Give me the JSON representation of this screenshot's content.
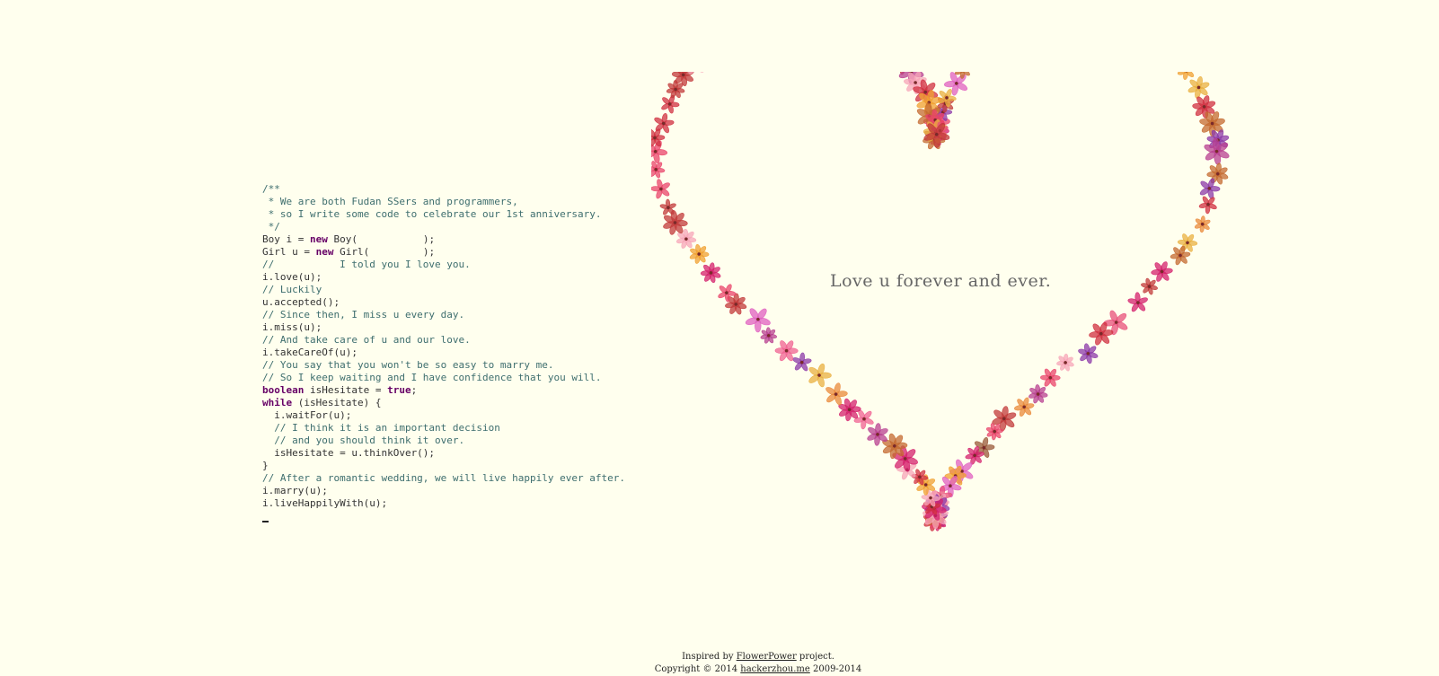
{
  "code": {
    "lines": [
      [
        {
          "cls": "comments",
          "text": "/**"
        }
      ],
      [
        {
          "cls": "comments",
          "text": " * We are both Fudan SSers and programmers,"
        }
      ],
      [
        {
          "cls": "comments",
          "text": " * so I write some code to celebrate our 1st anniversary."
        }
      ],
      [
        {
          "cls": "comments",
          "text": " */"
        }
      ],
      [
        {
          "cls": "",
          "text": "Boy i = "
        },
        {
          "cls": "keyword",
          "text": "new"
        },
        {
          "cls": "",
          "text": " Boy("
        },
        {
          "cls": "",
          "text": "           "
        },
        {
          "cls": "",
          "text": ");"
        }
      ],
      [
        {
          "cls": "",
          "text": "Girl u = "
        },
        {
          "cls": "keyword",
          "text": "new"
        },
        {
          "cls": "",
          "text": " Girl("
        },
        {
          "cls": "",
          "text": "         "
        },
        {
          "cls": "",
          "text": ");"
        }
      ],
      [
        {
          "cls": "comments",
          "text": "//           I told you I love you."
        }
      ],
      [
        {
          "cls": "",
          "text": "i.love(u);"
        }
      ],
      [
        {
          "cls": "comments",
          "text": "// Luckily"
        }
      ],
      [
        {
          "cls": "",
          "text": "u.accepted();"
        }
      ],
      [
        {
          "cls": "comments",
          "text": "// Since then, I miss u every day."
        }
      ],
      [
        {
          "cls": "",
          "text": "i.miss(u);"
        }
      ],
      [
        {
          "cls": "comments",
          "text": "// And take care of u and our love."
        }
      ],
      [
        {
          "cls": "",
          "text": "i.takeCareOf(u);"
        }
      ],
      [
        {
          "cls": "comments",
          "text": "// You say that you won't be so easy to marry me."
        }
      ],
      [
        {
          "cls": "comments",
          "text": "// So I keep waiting and I have confidence that you will."
        }
      ],
      [
        {
          "cls": "keyword",
          "text": "boolean"
        },
        {
          "cls": "",
          "text": " isHesitate = "
        },
        {
          "cls": "keyword",
          "text": "true"
        },
        {
          "cls": "",
          "text": ";"
        }
      ],
      [
        {
          "cls": "keyword",
          "text": "while"
        },
        {
          "cls": "",
          "text": " (isHesitate) {"
        }
      ],
      [
        {
          "cls": "",
          "text": "  i.waitFor(u);"
        }
      ],
      [
        {
          "cls": "comments",
          "text": "  // I think it is an important decision"
        }
      ],
      [
        {
          "cls": "comments",
          "text": "  // and you should think it over."
        }
      ],
      [
        {
          "cls": "",
          "text": "  isHesitate = u.thinkOver();"
        }
      ],
      [
        {
          "cls": "",
          "text": "}"
        }
      ],
      [
        {
          "cls": "comments",
          "text": "// After a romantic wedding, we will live happily ever after."
        }
      ],
      [
        {
          "cls": "",
          "text": "i.marry(u);"
        }
      ],
      [
        {
          "cls": "",
          "text": "i.liveHappilyWith(u);"
        }
      ]
    ]
  },
  "message": "Love u forever and ever.",
  "footer": {
    "line1_prefix": "Inspired by ",
    "line1_link": "FlowerPower",
    "line1_suffix": " project.",
    "line2_prefix": "Copyright © 2014 ",
    "line2_link": "hackerzhou.me",
    "line2_suffix": " 2009-2014"
  },
  "heart": {
    "flower_colors": [
      "#e8507a",
      "#f06292",
      "#e9446a",
      "#d4206c",
      "#f0a030",
      "#e98a3a",
      "#c46a30",
      "#d03040",
      "#b84090",
      "#e060c0",
      "#f7a6b8",
      "#c23a3a",
      "#9a5a3a",
      "#e9b040",
      "#8c3aa8"
    ]
  }
}
